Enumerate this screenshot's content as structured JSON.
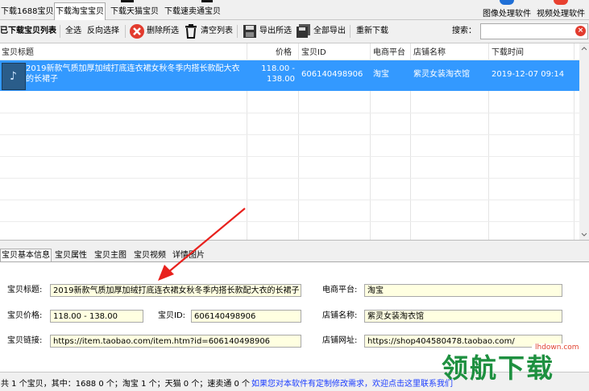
{
  "top_tabs": [
    "下载1688宝贝",
    "下载淘宝宝贝",
    "下载天猫宝贝",
    "下载速卖通宝贝"
  ],
  "top_right": [
    "图像处理软件",
    "视频处理软件"
  ],
  "toolbar": {
    "list_label": "已下载宝贝列表",
    "select_all": "全选",
    "invert": "反向选择",
    "delete_selected": "删除所选",
    "clear_list": "清空列表",
    "export_selected": "导出所选",
    "export_all": "全部导出",
    "redownload": "重新下载",
    "search_label": "搜索：",
    "search_value": ""
  },
  "columns": [
    "宝贝标题",
    "价格",
    "宝贝ID",
    "电商平台",
    "店铺名称",
    "下载时间"
  ],
  "rows": [
    {
      "title": "2019新款气质加厚加绒打底连衣裙女秋冬季内搭长款配大衣的长裙子",
      "price_line1": "118.00 -",
      "price_line2": "138.00",
      "id": "606140498906",
      "platform": "淘宝",
      "shop": "紫灵女装淘衣馆",
      "time": "2019-12-07 09:14"
    }
  ],
  "detail_tabs": [
    "宝贝基本信息",
    "宝贝属性",
    "宝贝主图",
    "宝贝视频",
    "详情图片"
  ],
  "detail": {
    "title_label": "宝贝标题:",
    "title_value": "2019新款气质加厚加绒打底连衣裙女秋冬季内搭长款配大衣的长裙子",
    "platform_label": "电商平台:",
    "platform_value": "淘宝",
    "price_label": "宝贝价格:",
    "price_value": "118.00 - 138.00",
    "id_label": "宝贝ID:",
    "id_value": "606140498906",
    "shop_label": "店铺名称:",
    "shop_value": "紫灵女装淘衣馆",
    "link_label": "宝贝链接:",
    "link_value": "https://item.taobao.com/item.htm?id=606140498906",
    "shop_url_label": "店铺网址:",
    "shop_url_value": "https://shop404580478.taobao.com/"
  },
  "status": {
    "counts": "共 1 个宝贝，其中：1688 0 个；淘宝 1 个；天猫 0 个；速卖通 0 个",
    "link": "如果您对本软件有定制修改需求，欢迎点击这里联系我们"
  },
  "watermark": {
    "small": "lhdown.com",
    "big": "领航下载"
  },
  "colors": {
    "selection": "#3399ff",
    "field_bg": "#ffffe1",
    "arrow": "#e8211d"
  }
}
